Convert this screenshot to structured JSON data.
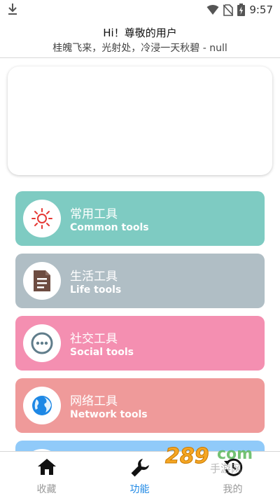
{
  "status_bar": {
    "time": "9:57"
  },
  "header": {
    "greeting": "Hi！尊敬的用户",
    "poem": "桂魄飞来，光射处，冷浸一天秋碧 - null"
  },
  "tools": [
    {
      "title": "常用工具",
      "subtitle": "Common tools",
      "color": "#7ecbc2",
      "icon": "sun-icon"
    },
    {
      "title": "生活工具",
      "subtitle": "Life tools",
      "color": "#b0bec5",
      "icon": "document-icon"
    },
    {
      "title": "社交工具",
      "subtitle": "Social tools",
      "color": "#f48fb1",
      "icon": "chat-dots-icon"
    },
    {
      "title": "网络工具",
      "subtitle": "Network tools",
      "color": "#ef9a9a",
      "icon": "globe-icon"
    },
    {
      "color": "#90caf9"
    }
  ],
  "tabs": [
    {
      "label": "收藏",
      "icon": "home-icon"
    },
    {
      "label": "功能",
      "icon": "wrench-icon",
      "active": true
    },
    {
      "label": "我的",
      "icon": "history-icon"
    }
  ],
  "watermark": {
    "text": "289",
    "domain": "com",
    "brand": "手游网"
  },
  "colors": {
    "accent": "#1e88e5",
    "inactive": "#9a9a9a"
  }
}
